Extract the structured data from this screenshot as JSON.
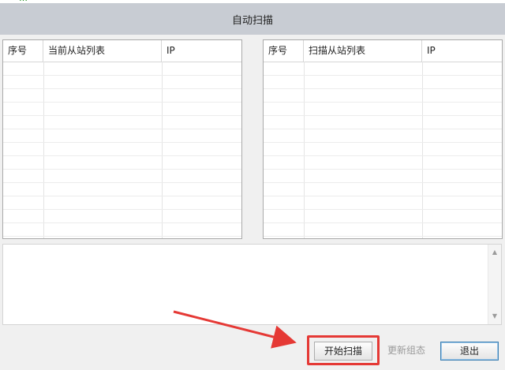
{
  "window": {
    "title": "自动扫描",
    "top_strip_text": "…"
  },
  "left_table": {
    "headers": [
      "序号",
      "当前从站列表",
      "IP"
    ],
    "rows": []
  },
  "right_table": {
    "headers": [
      "序号",
      "扫描从站列表",
      "IP"
    ],
    "rows": []
  },
  "log": {
    "text": ""
  },
  "buttons": {
    "start": "开始扫描",
    "update": "更新组态",
    "exit": "退出"
  },
  "colors": {
    "annotation": "#e53935",
    "titlebar": "#c8ccd3"
  }
}
